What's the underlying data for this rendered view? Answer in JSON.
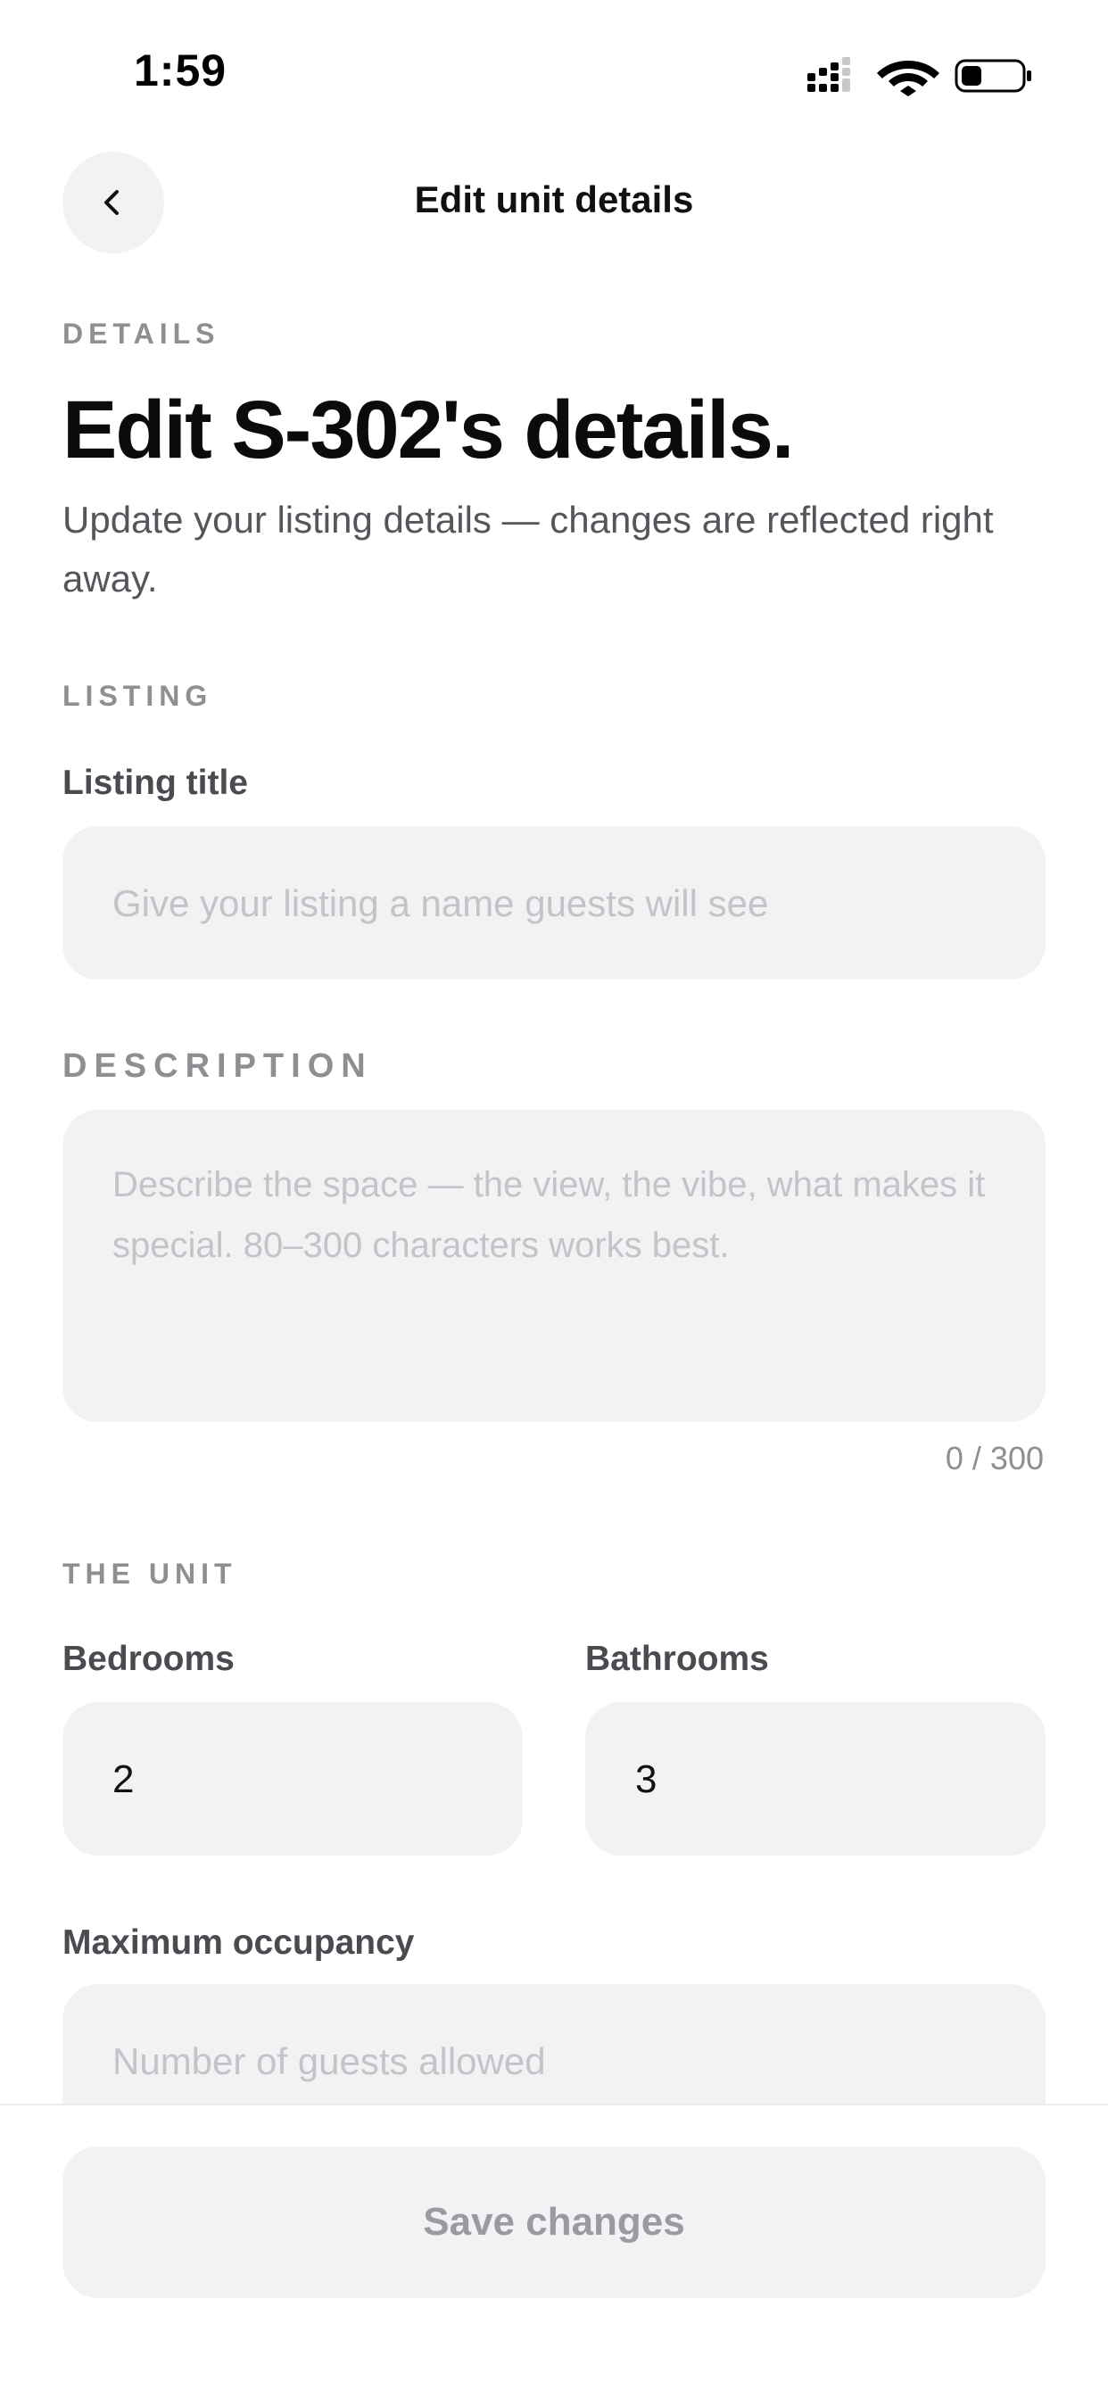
{
  "status_bar": {
    "time": "1:59",
    "icons": [
      "cellular-signal-icon",
      "wifi-icon",
      "battery-icon"
    ]
  },
  "header": {
    "back_icon": "chevron-left-icon",
    "title": "Edit unit details"
  },
  "intro": {
    "section_label": "DETAILS",
    "heading": "Edit S-302's details.",
    "subtitle": "Update your listing details — changes are reflected right away."
  },
  "listing": {
    "section_label": "LISTING",
    "title_label": "Listing title",
    "title_value": "",
    "title_placeholder": "Give your listing a name guests will see",
    "description_label": "DESCRIPTION",
    "description_value": "",
    "description_placeholder": "Describe the space — the view, the vibe, what makes it special. 80–300 characters works best.",
    "description_counter": "0 / 300"
  },
  "unit": {
    "section_label": "THE UNIT",
    "bedrooms_label": "Bedrooms",
    "bedrooms_value": "2",
    "bathrooms_label": "Bathrooms",
    "bathrooms_value": "3",
    "occupancy_label": "Maximum occupancy",
    "occupancy_value": "",
    "occupancy_placeholder": "Number of guests allowed"
  },
  "footer": {
    "save_label": "Save changes"
  },
  "colors": {
    "background": "#ffffff",
    "input_background": "#f2f2f4",
    "label_gray": "#8e8e93",
    "placeholder_gray": "#c4c4c8",
    "heading": "#0b0b0b"
  }
}
